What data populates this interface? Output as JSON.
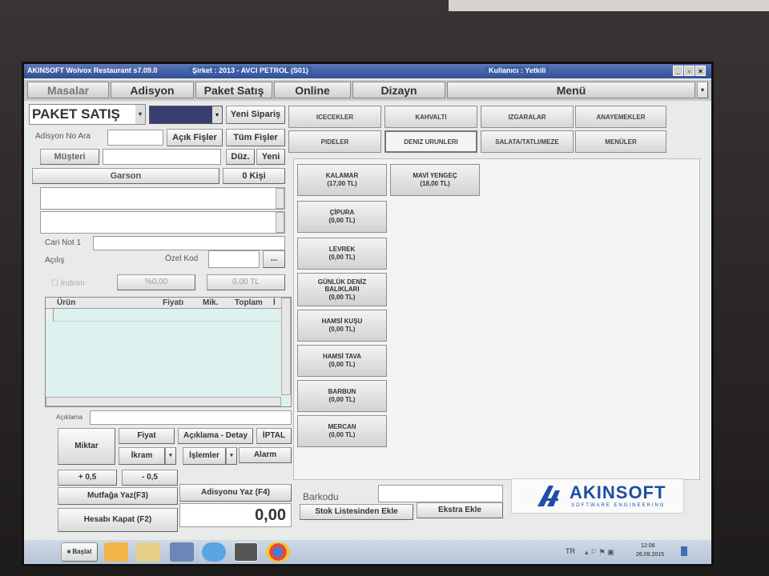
{
  "window": {
    "app_title": "AKINSOFT Wolvox Restaurant s7.09.0",
    "company": "Şirket : 2013 - AVCI PETROL (S01)",
    "user": "Kullanıcı : Yetkili",
    "controls": {
      "minimize": "_",
      "restore": "▫",
      "close": "×"
    }
  },
  "menu": {
    "tabs": [
      "Masalar",
      "Adisyon",
      "Paket Satış",
      "Online",
      "Dizayn",
      "Menü"
    ],
    "scroll": "▾"
  },
  "left": {
    "mode": "PAKET SATIŞ",
    "dropdown_arrow": "▾",
    "new_order": "Yeni Sipariş",
    "order_search_label": "Adisyon No Ara",
    "open_receipts": "Açık Fişler",
    "all_receipts": "Tüm Fişler",
    "customer_button": "Müşteri",
    "edit_button": "Düz.",
    "new_button": "Yeni",
    "waiter_button": "Garson",
    "person_count": "0 Kişi",
    "cari_note_label": "Cari Not 1",
    "opening_label": "Açılış",
    "special_code_label": "Özel Kod",
    "ellipsis": "...",
    "discount_check": "☐",
    "discount_label": "İndirim",
    "discount_percent": "%0,00",
    "discount_amount": "0,00 TL",
    "grid_headers": [
      "Ürün",
      "Fiyatı",
      "Mik.",
      "Toplam",
      "İ"
    ],
    "description_label": "Açıklama",
    "buttons": {
      "quantity": "Miktar",
      "price": "Fiyat",
      "description_detail": "Açıklama - Detay",
      "cancel": "İPTAL",
      "treat": "İkram",
      "operations": "İşlemler",
      "alarm": "Alarm",
      "plus": "+ 0,5",
      "minus": "- 0,5",
      "kitchen_print": "Mutfağa Yaz(F3)",
      "receipt_print": "Adisyonu Yaz (F4)",
      "close_bill": "Hesabı Kapat (F2)"
    },
    "total": "0,00"
  },
  "categories": [
    "ICECEKLER",
    "KAHVALTI",
    "IZGARALAR",
    "ANAYEMEKLER",
    "PIDELER",
    "DENIZ URUNLERI",
    "SALATA/TATLI/MEZE",
    "MENÜLER"
  ],
  "products": [
    {
      "name": "KALAMAR",
      "price": "(17,00 TL)"
    },
    {
      "name": "MAVİ YENGEÇ",
      "price": "(18,00 TL)"
    },
    {
      "name": "ÇİPURA",
      "price": "(0,00 TL)"
    },
    {
      "name": "LEVREK",
      "price": "(0,00 TL)"
    },
    {
      "name": "GÜNLÜK DENİZ BALIKLARI",
      "price": "(0,00 TL)"
    },
    {
      "name": "HAMSİ KUŞU",
      "price": "(0,00 TL)"
    },
    {
      "name": "HAMSİ TAVA",
      "price": "(0,00 TL)"
    },
    {
      "name": "BARBUN",
      "price": "(0,00 TL)"
    },
    {
      "name": "MERCAN",
      "price": "(0,00 TL)"
    }
  ],
  "barcode": {
    "label": "Barkodu",
    "add_from_stock": "Stok Listesinden Ekle",
    "extra_add": "Ekstra Ekle"
  },
  "brand": {
    "name": "AKINSOFT",
    "tagline": "SOFTWARE ENGINEERING",
    "color": "#1f4ea3"
  },
  "taskbar": {
    "start": "Başlat",
    "language": "TR",
    "time": "12:06",
    "date": "26.09.2015"
  }
}
